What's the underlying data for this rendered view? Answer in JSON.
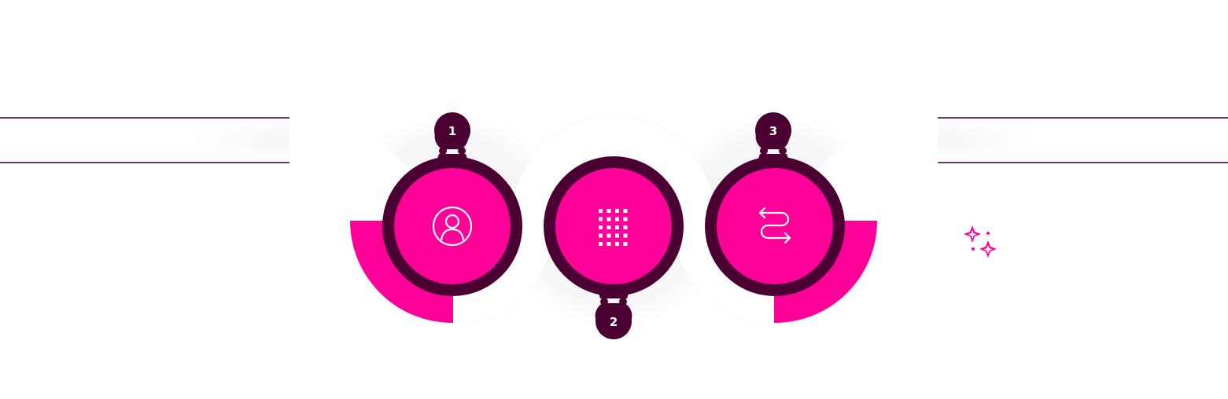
{
  "colors": {
    "primary": "#ff0099",
    "dark": "#4a0033",
    "line": "#6b3a63",
    "track": "#ffffff",
    "icon_stroke": "#ffffff"
  },
  "steps": [
    {
      "number": "1",
      "icon": "user-icon",
      "badge_position": "top"
    },
    {
      "number": "2",
      "icon": "grid-icon",
      "badge_position": "bottom"
    },
    {
      "number": "3",
      "icon": "arrows-exchange-icon",
      "badge_position": "top"
    }
  ],
  "decorations": {
    "sparkles": "sparkles-icon"
  }
}
